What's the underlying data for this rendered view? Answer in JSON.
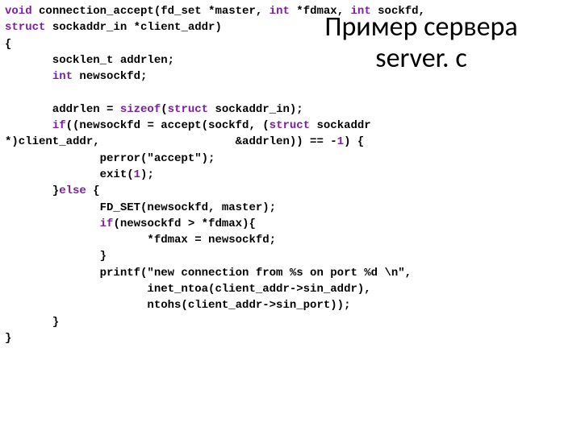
{
  "title_line1": "Пример сервера",
  "title_line2": "server. c",
  "c01a": "void",
  "c01b": " connection_accept(fd_set *master, ",
  "c01c": "int",
  "c01d": " *fdmax, ",
  "c01e": "int",
  "c01f": " sockfd,",
  "c02a": "struct",
  "c02b": " sockaddr_in *client_addr)",
  "c03": "{",
  "c04": "       socklen_t addrlen;",
  "c05a": "       ",
  "c05b": "int",
  "c05c": " newsockfd;",
  "c06": "",
  "c07a": "       addrlen = ",
  "c07b": "sizeof",
  "c07c": "(",
  "c07d": "struct",
  "c07e": " sockaddr_in);",
  "c08a": "       ",
  "c08b": "if",
  "c08c": "((newsockfd = accept(sockfd, (",
  "c08d": "struct",
  "c08e": " sockaddr",
  "c09a": "*)client_addr,                    &addrlen)) == -",
  "c09b": "1",
  "c09c": ") {",
  "c10": "              perror(\"accept\");",
  "c11a": "              exit(",
  "c11b": "1",
  "c11c": ");",
  "c12a": "       }",
  "c12b": "else",
  "c12c": " {",
  "c13": "              FD_SET(newsockfd, master);",
  "c14a": "              ",
  "c14b": "if",
  "c14c": "(newsockfd > *fdmax){",
  "c15": "                     *fdmax = newsockfd;",
  "c16": "              }",
  "c17": "              printf(\"new connection from %s on port %d \\n\",",
  "c18": "                     inet_ntoa(client_addr->sin_addr),",
  "c19": "                     ntohs(client_addr->sin_port));",
  "c20": "       }",
  "c21": "}"
}
